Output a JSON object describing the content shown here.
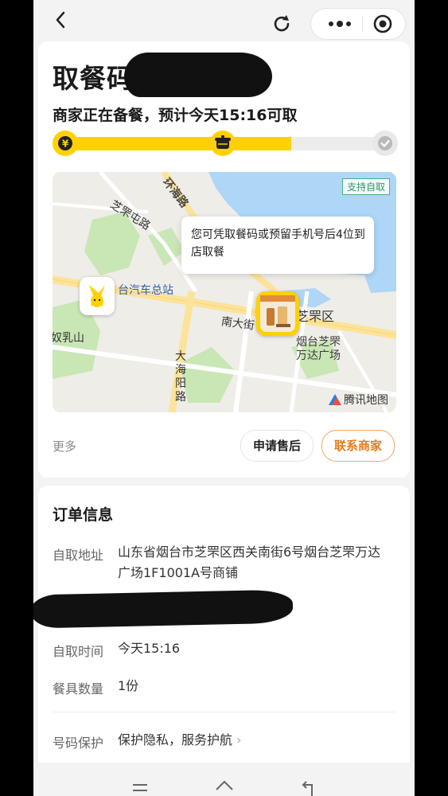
{
  "header": {
    "back_icon": "chevron-left-icon",
    "refresh_icon": "refresh-icon",
    "more_icon": "more-dots-icon",
    "close_icon": "target-icon"
  },
  "pickup": {
    "title": "取餐码",
    "status": "商家正在备餐，预计今天15:16可取",
    "progress": 0.72,
    "steps": [
      {
        "icon": "yen-coin-icon",
        "state": "done"
      },
      {
        "icon": "cooking-icon",
        "state": "current"
      },
      {
        "icon": "check-icon",
        "state": "pending"
      }
    ]
  },
  "map": {
    "badge": "支持自取",
    "bubble_text": "您可凭取餐码或预留手机号后4位到店取餐",
    "labels": {
      "road1": "环海路",
      "road2": "芝罘屯路",
      "station": "台汽车总站",
      "district": "芝罘区",
      "street": "南大街",
      "mountain": "奴乳山",
      "mall": "烟台芝罘万达广场",
      "road3": "大海阳路"
    },
    "provider": "腾讯地图"
  },
  "actions": {
    "more": "更多",
    "after_sale": "申请售后",
    "contact": "联系商家"
  },
  "order": {
    "section_title": "订单信息",
    "address_label": "自取地址",
    "address_value": "山东省烟台市芝罘区西关南街6号烟台芝罘万达广场1F1001A号商铺",
    "time_label": "自取时间",
    "time_value": "今天15:16",
    "utensils_label": "餐具数量",
    "utensils_value": "1份",
    "privacy_label": "号码保护",
    "privacy_value": "保护隐私，服务护航",
    "privacy_chevron": "›"
  },
  "colors": {
    "accent": "#ffd100",
    "orange": "#e47c1e",
    "water": "#aed6f6",
    "park": "#c9e6b5"
  },
  "nav": {
    "menu_icon": "menu-icon",
    "home_icon": "home-icon",
    "back_icon": "back-arrow-icon"
  }
}
